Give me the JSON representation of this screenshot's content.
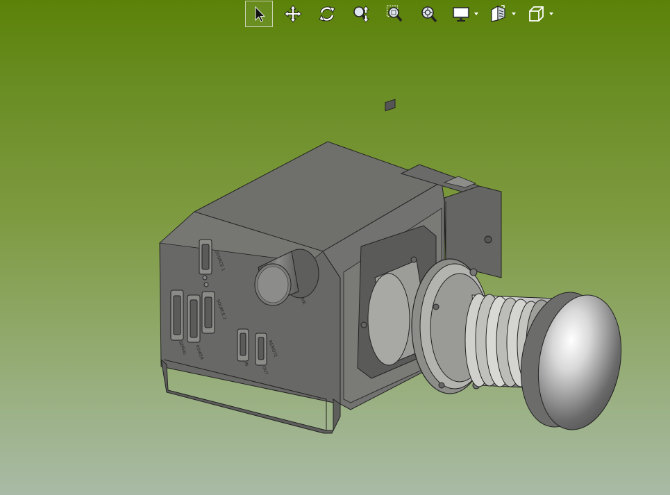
{
  "toolbar": {
    "tools": [
      {
        "id": "select",
        "icon": "select-arrow-icon",
        "active": true
      },
      {
        "id": "pan",
        "icon": "pan-move-icon"
      },
      {
        "id": "rotate",
        "icon": "rotate-icon"
      },
      {
        "id": "zoom-updown",
        "icon": "zoom-in-out-icon"
      },
      {
        "id": "zoom-area",
        "icon": "zoom-to-area-icon"
      },
      {
        "id": "zoom-fit",
        "icon": "zoom-to-fit-icon"
      },
      {
        "id": "display-style",
        "icon": "display-monitor-icon",
        "dropdown": true
      },
      {
        "id": "hide-show",
        "icon": "hide-show-items-icon",
        "dropdown": true
      },
      {
        "id": "view-orientation",
        "icon": "view-cube-icon",
        "dropdown": true
      }
    ]
  },
  "model": {
    "panel_labels": {
      "source1": "SOURCE 1",
      "source2": "SOURCE 2",
      "serial": "SERIAL",
      "power": "POWER",
      "in": "IN",
      "out": "OUT",
      "remote": "REMOTE",
      "pwr": "PWR"
    }
  },
  "colors": {
    "background_top": "#5b8208",
    "background_bottom": "#a9bba6",
    "body": "#6f6f6d"
  }
}
